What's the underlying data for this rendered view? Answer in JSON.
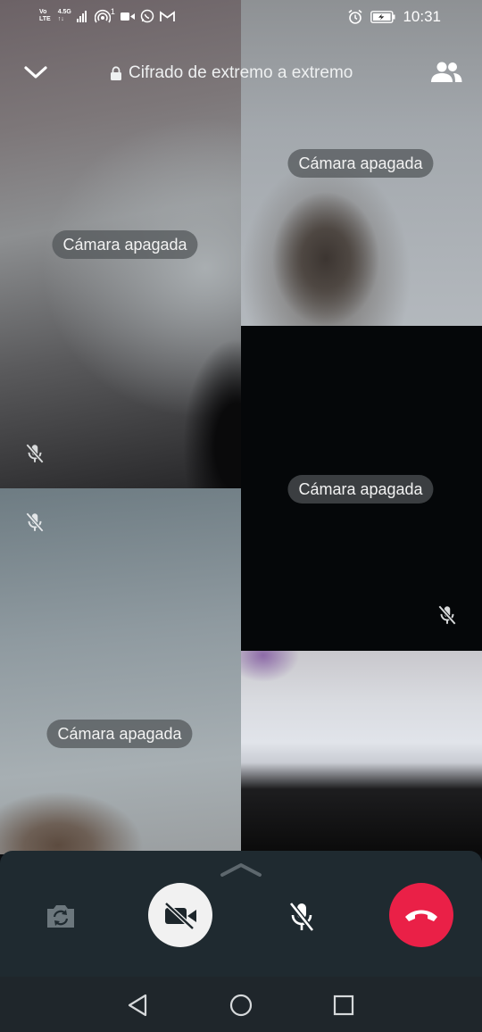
{
  "status_bar": {
    "network_top": "Vo",
    "network_bottom": "LTE",
    "speed_top": "4.5G",
    "speed_bottom": "↑↓",
    "notification_count": "1",
    "time": "10:31",
    "icons": [
      "volte-icon",
      "signal-icon",
      "hotspot-icon",
      "video-recording-icon",
      "whatsapp-icon",
      "gmail-icon",
      "alarm-icon",
      "battery-charging-icon"
    ]
  },
  "header": {
    "encryption_text": "Cifrado de extremo a extremo",
    "icons": [
      "chevron-down-icon",
      "lock-icon",
      "participants-icon"
    ]
  },
  "participants": [
    {
      "id": "p1",
      "status": "Cámara apagada",
      "muted": true
    },
    {
      "id": "p2",
      "status": "Cámara apagada",
      "muted": false
    },
    {
      "id": "p3",
      "status": "Cámara apagada",
      "muted": true
    },
    {
      "id": "p4",
      "status": "Cámara apagada",
      "muted": true
    },
    {
      "id": "p5",
      "status": "",
      "muted": false
    }
  ],
  "controls": {
    "icons": [
      "chevron-up-icon",
      "flip-camera-icon",
      "video-off-icon",
      "mic-off-icon",
      "end-call-icon"
    ],
    "end_call_color": "#ea2047",
    "video_button_color": "#f1f1f1",
    "panel_color": "#1f2a30"
  },
  "navigation": {
    "icons": [
      "back-icon",
      "home-icon",
      "recents-icon"
    ]
  }
}
